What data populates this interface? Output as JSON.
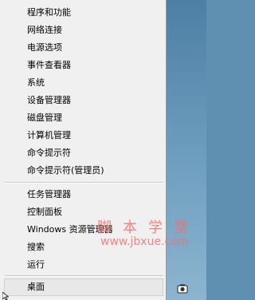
{
  "menu": {
    "items": [
      {
        "label": "程序和功能"
      },
      {
        "label": "网络连接"
      },
      {
        "label": "电源选项"
      },
      {
        "label": "事件查看器"
      },
      {
        "label": "系统"
      },
      {
        "label": "设备管理器"
      },
      {
        "label": "磁盘管理"
      },
      {
        "label": "计算机管理"
      },
      {
        "label": "命令提示符"
      },
      {
        "label": "命令提示符(管理员)"
      },
      {
        "label": "任务管理器"
      },
      {
        "label": "控制面板"
      },
      {
        "label": "Windows 资源管理器"
      },
      {
        "label": "搜索"
      },
      {
        "label": "运行"
      }
    ],
    "desktop_label": "桌面"
  },
  "watermark": {
    "chars": "脚本学堂",
    "url": "www.jbxue.com"
  },
  "tray": {
    "icon": "tray-app-icon"
  },
  "colors": {
    "menu_bg": "#f0f0f0",
    "desktop_bg": "#5f8fb1",
    "watermark": "#f36f6f"
  }
}
